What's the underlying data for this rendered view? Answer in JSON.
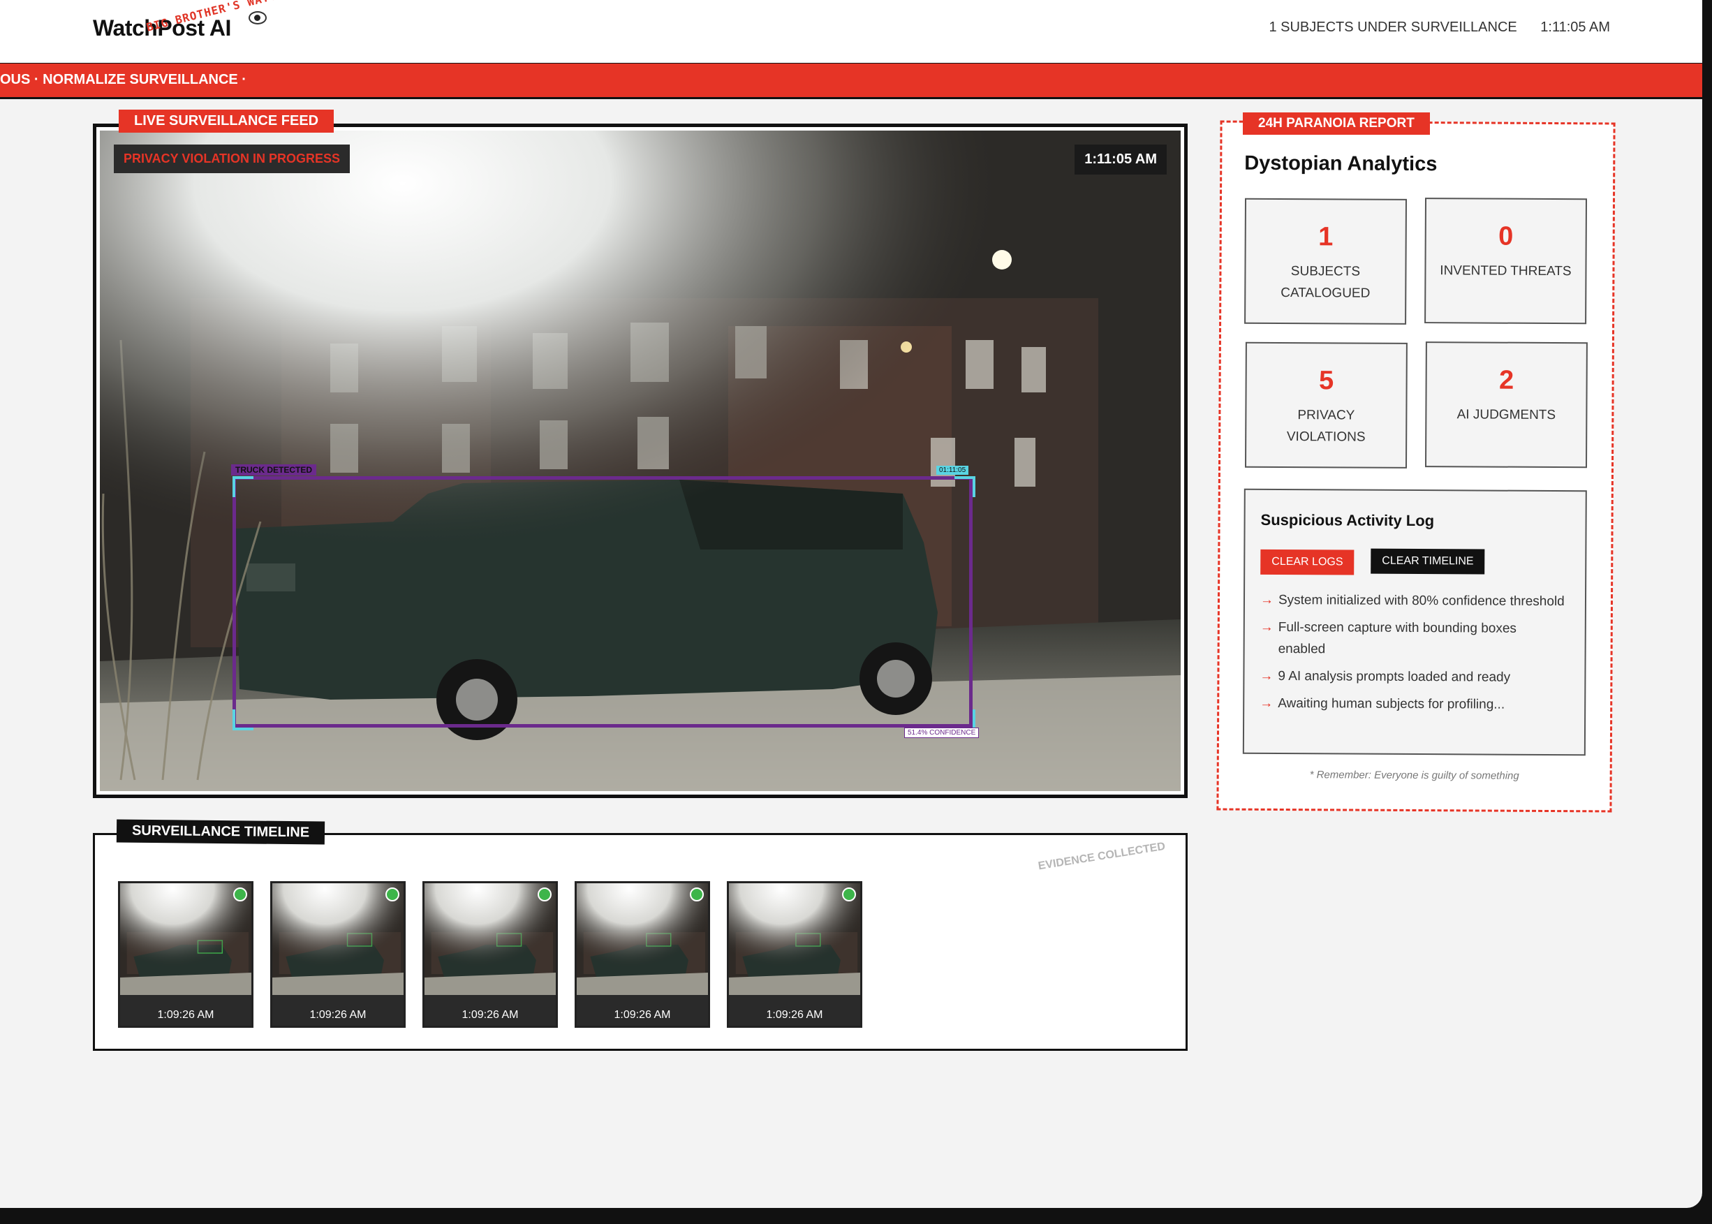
{
  "header": {
    "brand": "WatchPost AI",
    "tagline": "BIG BROTHER'S WATCHING!",
    "subjects_status": "1 SUBJECTS UNDER SURVEILLANCE",
    "clock": "1:11:05 AM"
  },
  "ticker": {
    "text": "OUS · NORMALIZE SURVEILLANCE ·"
  },
  "feed": {
    "section_label": "LIVE SURVEILLANCE FEED",
    "violation_badge": "PRIVACY VIOLATION IN PROGRESS",
    "timestamp": "1:11:05 AM",
    "detection": {
      "label": "TRUCK DETECTED",
      "time": "01:11:05",
      "confidence": "51.4% CONFIDENCE"
    }
  },
  "timeline": {
    "section_label": "SURVEILLANCE TIMELINE",
    "stamp": "EVIDENCE COLLECTED",
    "snapshots": [
      {
        "time": "1:09:26 AM"
      },
      {
        "time": "1:09:26 AM"
      },
      {
        "time": "1:09:26 AM"
      },
      {
        "time": "1:09:26 AM"
      },
      {
        "time": "1:09:26 AM"
      }
    ]
  },
  "report": {
    "section_label": "24H PARANOIA REPORT",
    "title": "Dystopian Analytics",
    "stats": [
      {
        "value": "1",
        "label": "SUBJECTS CATALOGUED"
      },
      {
        "value": "0",
        "label": "INVENTED THREATS"
      },
      {
        "value": "5",
        "label": "PRIVACY VIOLATIONS"
      },
      {
        "value": "2",
        "label": "AI JUDGMENTS"
      }
    ],
    "log": {
      "title": "Suspicious Activity Log",
      "clear_logs": "CLEAR LOGS",
      "clear_timeline": "CLEAR TIMELINE",
      "arrow": "→",
      "entries": [
        "System initialized with 80% confidence threshold",
        "Full-screen capture with bounding boxes enabled",
        "9 AI analysis prompts loaded and ready",
        "Awaiting human subjects for profiling..."
      ]
    },
    "footnote": "* Remember: Everyone is guilty of something"
  },
  "colors": {
    "accent": "#e63426",
    "detection_box": "#6b2a8c",
    "detection_corner": "#59d4e3",
    "status_dot": "#3db54a"
  }
}
